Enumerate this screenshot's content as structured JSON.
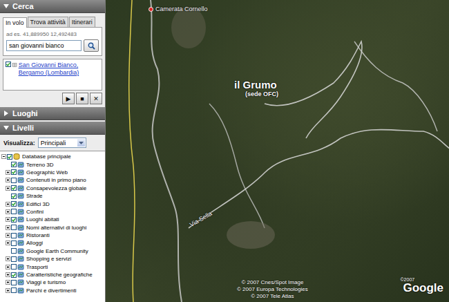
{
  "search": {
    "title": "Cerca",
    "expanded": true,
    "tabs": [
      {
        "label": "In volo",
        "selected": true
      },
      {
        "label": "Trova attività",
        "selected": false
      },
      {
        "label": "Itinerari",
        "selected": false
      }
    ],
    "hint": "ad es. 41,889950 12,492483",
    "query": "san giovanni bianco",
    "results": [
      {
        "label": "San Giovanni Bianco, Bergamo (Lombardia)",
        "checked": true
      }
    ],
    "controls": [
      "▶",
      "■",
      "✕"
    ]
  },
  "places": {
    "title": "Luoghi",
    "expanded": false
  },
  "layers": {
    "title": "Livelli",
    "expanded": true,
    "view_label": "Visualizza:",
    "view_value": "Principali",
    "root": {
      "label": "Database principale",
      "checked": true,
      "expanded": true
    },
    "items": [
      {
        "label": "Terreno 3D",
        "checked": true,
        "expandable": false
      },
      {
        "label": "Geographic Web",
        "checked": true,
        "expandable": true
      },
      {
        "label": "Contenuti in primo piano",
        "checked": false,
        "expandable": true
      },
      {
        "label": "Consapevolezza globale",
        "checked": true,
        "expandable": true
      },
      {
        "label": "Strade",
        "checked": true,
        "expandable": false
      },
      {
        "label": "Edifici 3D",
        "checked": true,
        "expandable": true
      },
      {
        "label": "Confini",
        "checked": false,
        "expandable": true
      },
      {
        "label": "Luoghi abitati",
        "checked": true,
        "expandable": true
      },
      {
        "label": "Nomi alternativi di luoghi",
        "checked": false,
        "expandable": true
      },
      {
        "label": "Ristoranti",
        "checked": false,
        "expandable": true
      },
      {
        "label": "Alloggi",
        "checked": false,
        "expandable": true
      },
      {
        "label": "Google Earth Community",
        "checked": false,
        "expandable": false
      },
      {
        "label": "Shopping e servizi",
        "checked": false,
        "expandable": true
      },
      {
        "label": "Trasporti",
        "checked": false,
        "expandable": true
      },
      {
        "label": "Caratteristiche geografiche",
        "checked": true,
        "expandable": true
      },
      {
        "label": "Viaggi e turismo",
        "checked": false,
        "expandable": true
      },
      {
        "label": "Parchi e divertimenti",
        "checked": false,
        "expandable": true
      }
    ]
  },
  "map": {
    "labels": [
      {
        "text": "Camerata Cornello",
        "kind": "town"
      },
      {
        "text": "il Grumo",
        "kind": "title"
      },
      {
        "text": "(sede OFC)",
        "kind": "subtitle"
      },
      {
        "text": "Via Sella",
        "kind": "road"
      }
    ],
    "copyright": [
      "© 2007 Cnes/Spot Image",
      "© 2007 Europa Technologies",
      "© 2007 Tele Atlas"
    ],
    "logo": {
      "text": "Google",
      "year": "©2007"
    }
  }
}
